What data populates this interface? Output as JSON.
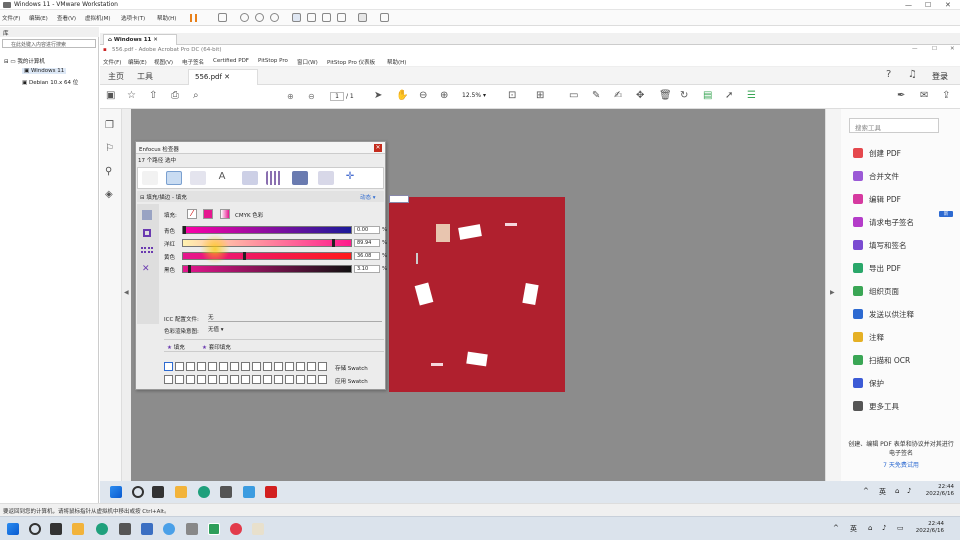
{
  "vmware": {
    "title": "Windows 11 - VMware Workstation",
    "menu": [
      "文件(F)",
      "编辑(E)",
      "查看(V)",
      "虚拟机(M)",
      "选项卡(T)",
      "帮助(H)"
    ],
    "library_search": "在此处键入内容进行搜索",
    "library_root": "我的计算机",
    "vms": [
      "Windows 11",
      "Debian 10.x 64 位"
    ],
    "tab": "Windows 11",
    "status": "要返回到您的计算机，请将鼠标指针从虚拟机中移出或按 Ctrl+Alt。"
  },
  "acrobat": {
    "window_title": "556.pdf - Adobe Acrobat Pro DC (64-bit)",
    "menu": [
      "文件(F)",
      "编辑(E)",
      "视图(V)",
      "电子签名",
      "Certified PDF",
      "PitStop Pro",
      "窗口(W)",
      "PitStop Pro 仪表板",
      "帮助(H)"
    ],
    "tab_home": "主页",
    "tab_tools": "工具",
    "doc_tab": "556.pdf",
    "login": "登录",
    "page_current": "1",
    "page_total": "/ 1",
    "zoom": "12.5%",
    "right_search": "搜索工具",
    "tools": [
      {
        "label": "创建 PDF",
        "color": "#e5484d"
      },
      {
        "label": "合并文件",
        "color": "#9b59d6"
      },
      {
        "label": "编辑 PDF",
        "color": "#d63aa0"
      },
      {
        "label": "请求电子签名",
        "color": "#b43cc9"
      },
      {
        "label": "填写和签名",
        "color": "#7a4bd1"
      },
      {
        "label": "导出 PDF",
        "color": "#2aa76a"
      },
      {
        "label": "组织页面",
        "color": "#3aa655"
      },
      {
        "label": "发送以供注释",
        "color": "#2d6ad1"
      },
      {
        "label": "注释",
        "color": "#e5b024"
      },
      {
        "label": "扫描和 OCR",
        "color": "#3aa655"
      },
      {
        "label": "保护",
        "color": "#3c5bd6"
      },
      {
        "label": "更多工具",
        "color": "#555555"
      }
    ],
    "new_badge": "新",
    "promo_text": "创建、编辑 PDF 表单和协议并对其进行电子签名",
    "promo_link": "7 天免费试用"
  },
  "enfocus": {
    "title": "Enfocus 检查器",
    "subtitle": "17 个路径 选中",
    "section": "填充/描边 - 填充",
    "dynamic": "动态",
    "fill_label": "填充:",
    "colorspace": "CMYK 色彩",
    "channels": [
      {
        "name": "青色",
        "value": "0.00",
        "unit": "%",
        "from": "#ff00a8",
        "to": "#1a1a99"
      },
      {
        "name": "洋红",
        "value": "89.94",
        "unit": "%",
        "from": "#fff2b0",
        "to": "#ff1a8c"
      },
      {
        "name": "黄色",
        "value": "36.08",
        "unit": "%",
        "from": "#e6168f",
        "to": "#ff1a1a"
      },
      {
        "name": "黑色",
        "value": "3.10",
        "unit": "%",
        "from": "#e6168f",
        "to": "#111111"
      }
    ],
    "icc_label": "ICC 配置文件:",
    "icc_value": "无",
    "intent_label": "色彩渲染意图:",
    "intent_value": "无值",
    "fill_tab": "填充",
    "overprint_tab": "套印填充",
    "store_swatch": "存储 Swatch",
    "apply_swatch": "应用 Swatch",
    "accent": "#e6168f"
  },
  "clock": {
    "time": "22:44",
    "date": "2022/6/16"
  }
}
